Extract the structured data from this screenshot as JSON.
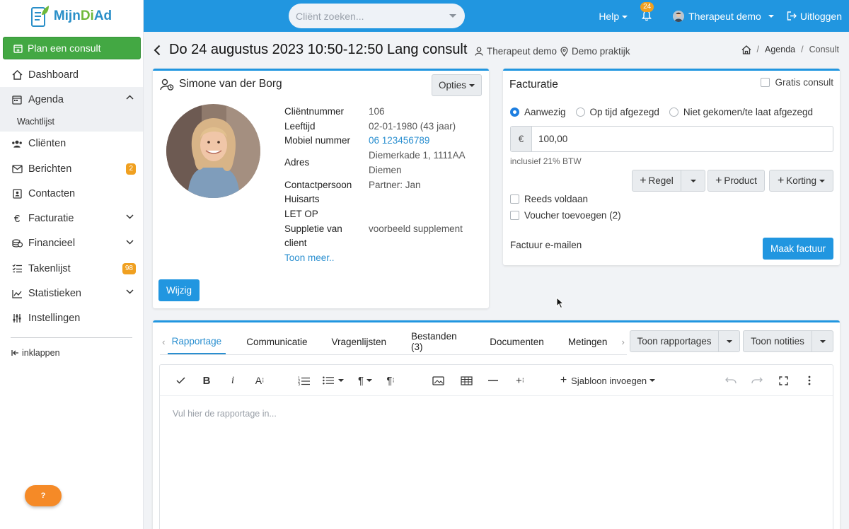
{
  "app": {
    "logo_left": "Mijn",
    "logo_mid": "Di",
    "logo_right": "Ad"
  },
  "sidebar": {
    "plan_button": "Plan een consult",
    "items": [
      {
        "label": "Dashboard",
        "icon": "home-icon"
      },
      {
        "label": "Agenda",
        "icon": "calendar-icon"
      },
      {
        "label": "Cliënten",
        "icon": "users-icon"
      },
      {
        "label": "Berichten",
        "icon": "envelope-icon",
        "badge": "2"
      },
      {
        "label": "Contacten",
        "icon": "contact-book-icon"
      },
      {
        "label": "Facturatie",
        "icon": "euro-icon"
      },
      {
        "label": "Financieel",
        "icon": "coins-icon"
      },
      {
        "label": "Takenlijst",
        "icon": "tasks-icon",
        "badge": "98"
      },
      {
        "label": "Statistieken",
        "icon": "chart-icon"
      },
      {
        "label": "Instellingen",
        "icon": "sliders-icon"
      }
    ],
    "subitem": "Wachtlijst",
    "collapse": "inklappen",
    "help": "?"
  },
  "topbar": {
    "search_placeholder": "Cliënt zoeken...",
    "help": "Help",
    "notifications": "24",
    "user": "Therapeut demo",
    "logout": "Uitloggen"
  },
  "page": {
    "title": "Do 24 augustus 2023 10:50-12:50 Lang consult",
    "therapist": "Therapeut demo",
    "location": "Demo praktijk",
    "breadcrumb": [
      "Agenda",
      "Consult"
    ]
  },
  "client": {
    "name": "Simone van der Borg",
    "options": "Opties",
    "fields": {
      "nummer_label": "Cliëntnummer",
      "nummer": "106",
      "leeftijd_label": "Leeftijd",
      "leeftijd": "02-01-1980 (43 jaar)",
      "mobiel_label": "Mobiel nummer",
      "mobiel": "06 123456789",
      "adres_label": "Adres",
      "adres_1": "Diemerkade 1, 1111AA",
      "adres_2": "Diemen",
      "contact_label": "Contactpersoon",
      "contact": "Partner: Jan",
      "huisarts_label": "Huisarts",
      "letop_label": "LET OP",
      "suppletie_label_1": "Suppletie van",
      "suppletie_label_2": "client",
      "suppletie": "voorbeeld supplement"
    },
    "more": "Toon meer..",
    "edit": "Wijzig"
  },
  "invoice": {
    "title": "Facturatie",
    "free": "Gratis consult",
    "radios": [
      "Aanwezig",
      "Op tijd afgezegd",
      "Niet gekomen/te laat afgezegd"
    ],
    "selected": "Aanwezig",
    "currency": "€",
    "amount": "100,00",
    "vat": "inclusief 21% BTW",
    "btn_regel": "Regel",
    "btn_product": "Product",
    "btn_korting": "Korting",
    "paid": "Reeds voldaan",
    "voucher": "Voucher toevoegen (2)",
    "email": "Factuur e-mailen",
    "make": "Maak factuur"
  },
  "report": {
    "tabs": [
      "Rapportage",
      "Communicatie",
      "Vragenlijsten",
      "Bestanden (3)",
      "Documenten",
      "Metingen"
    ],
    "active_tab": "Rapportage",
    "show_reports": "Toon rapportages",
    "show_notes": "Toon notities",
    "template": "Sjabloon invoegen",
    "placeholder": "Vul hier de rapportage in..."
  },
  "colors": {
    "primary": "#2196e0",
    "success": "#43a843",
    "badge": "#f0a020",
    "help": "#f58a27"
  }
}
